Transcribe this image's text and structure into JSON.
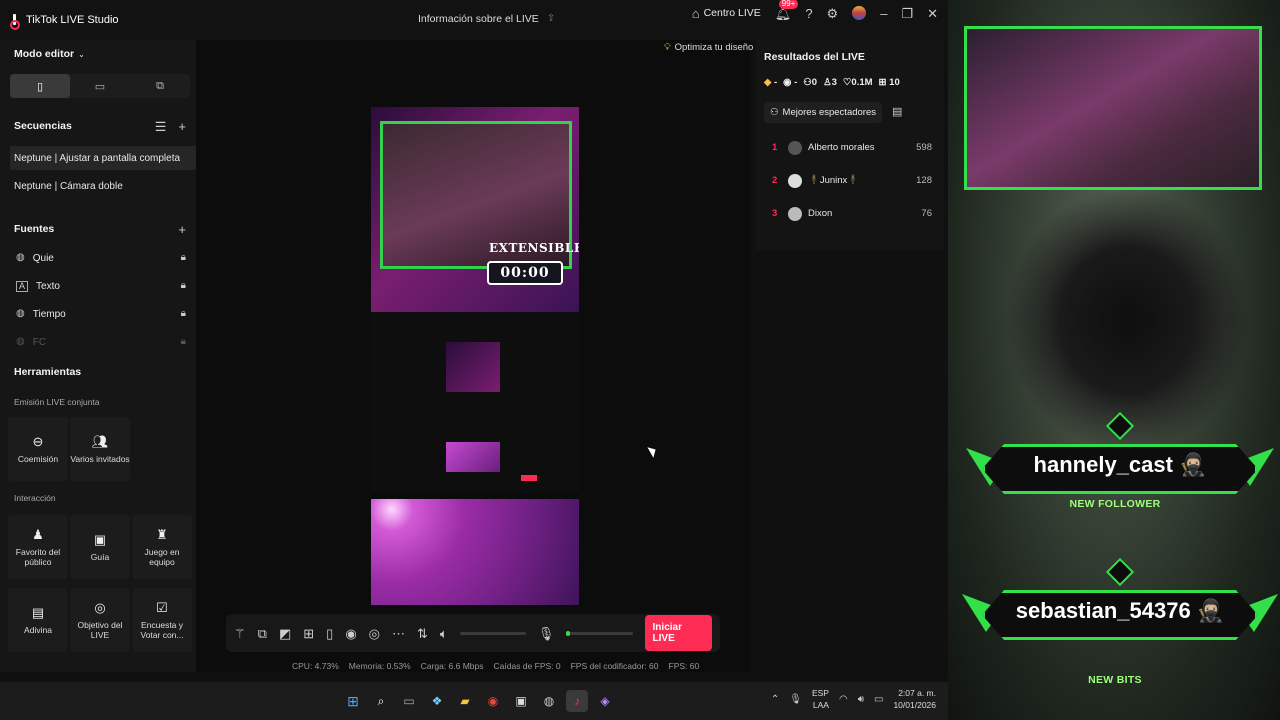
{
  "app": {
    "title": "TikTok LIVE Studio",
    "center_title": "Información sobre el LIVE",
    "centro": "Centro LIVE",
    "notif_badge": "99+"
  },
  "sidebar": {
    "mode": "Modo editor",
    "scenes_title": "Secuencias",
    "scenes": [
      "Neptune | Ajustar a pantalla completa",
      "Neptune | Cámara doble"
    ],
    "sources_title": "Fuentes",
    "sources": [
      {
        "label": "Quie",
        "icon": "globe-icon"
      },
      {
        "label": "Texto",
        "icon": "text-icon"
      },
      {
        "label": "Tiempo",
        "icon": "globe-icon"
      },
      {
        "label": "FC",
        "icon": "globe-icon"
      }
    ],
    "tools_title": "Herramientas",
    "joint_title": "Emisión LIVE conjunta",
    "joint": [
      "Coemisión",
      "Varios invitados"
    ],
    "interaction_title": "Interacción",
    "interaction": [
      "Favorito del público",
      "Guía",
      "Juego en equipo",
      "Adivina",
      "Objetivo del LIVE",
      "Encuesta y Votar con..."
    ]
  },
  "canvas": {
    "optimize": "Optimiza tu diseño",
    "ext": "EXTENSIBLE",
    "timer": "00:00"
  },
  "results": {
    "title": "Resultados del LIVE",
    "stats": [
      "-",
      "-",
      "0",
      "3",
      "0.1M",
      "10"
    ],
    "top_btn": "Mejores espectadores",
    "viewers": [
      {
        "rank": "1",
        "name": "Alberto morales",
        "score": "598"
      },
      {
        "rank": "2",
        "name": "🕴️Juninx🕴️",
        "score": "128"
      },
      {
        "rank": "3",
        "name": "Dixon",
        "score": "76"
      }
    ]
  },
  "bottombar": {
    "go_live": "Iniciar LIVE",
    "mic_level": 0.02
  },
  "metrics": [
    "CPU: 4.73%",
    "Memoria: 0.53%",
    "Carga: 6.6 Mbps",
    "Caídas de FPS: 0",
    "FPS del codificador: 60",
    "FPS: 60"
  ],
  "taskbar": {
    "lang1": "ESP",
    "lang2": "LAA",
    "time": "2:07 a. m.",
    "date": "10/01/2026"
  },
  "stream": {
    "alert1_name": "hannely_cast 🥷🏼",
    "alert1_sub": "NEW FOLLOWER",
    "alert2_name": "sebastian_54376 🥷🏼",
    "alert2_sub": "NEW BITS"
  }
}
